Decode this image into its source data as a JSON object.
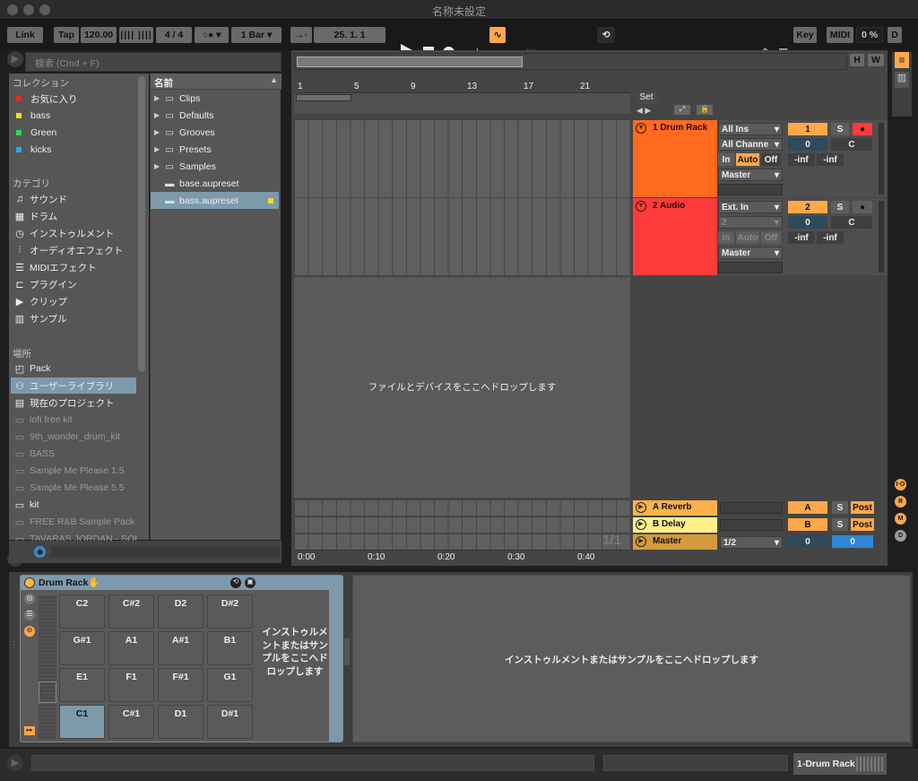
{
  "window": {
    "title": "名称未設定"
  },
  "control_bar": {
    "link": "Link",
    "tap": "Tap",
    "tempo": "120.00",
    "signature": "4 / 4",
    "quantize": "1 Bar",
    "position": "25.  1.  1",
    "key": "Key",
    "midi": "MIDI",
    "cpu": "0 %",
    "d": "D"
  },
  "search": {
    "placeholder": "検索 (Cmd + F)"
  },
  "sidebar": {
    "collections_header": "コレクション",
    "collections": [
      {
        "label": "お気に入り",
        "color": "#e52a2a"
      },
      {
        "label": "bass",
        "color": "#f0e020"
      },
      {
        "label": "Green",
        "color": "#2fd65a"
      },
      {
        "label": "kicks",
        "color": "#2aa9e8"
      }
    ],
    "categories_header": "カテゴリ",
    "categories": [
      {
        "label": "サウンド",
        "icon": "♫"
      },
      {
        "label": "ドラム",
        "icon": "▦"
      },
      {
        "label": "インストゥルメント",
        "icon": "◷"
      },
      {
        "label": "オーディオエフェクト",
        "icon": "⫶"
      },
      {
        "label": "MIDIエフェクト",
        "icon": "☰"
      },
      {
        "label": "プラグイン",
        "icon": "⊏"
      },
      {
        "label": "クリップ",
        "icon": "▶"
      },
      {
        "label": "サンプル",
        "icon": "▥"
      }
    ],
    "places_header": "場所",
    "places": [
      {
        "label": "Pack",
        "icon": "◰",
        "dim": false
      },
      {
        "label": "ユーザーライブラリ",
        "icon": "⚇",
        "dim": false
      },
      {
        "label": "現在のプロジェクト",
        "icon": "▤",
        "dim": false
      },
      {
        "label": "lofi free kit",
        "icon": "▭",
        "dim": true
      },
      {
        "label": "9th_wonder_drum_kit",
        "icon": "▭",
        "dim": true
      },
      {
        "label": "BASS",
        "icon": "▭",
        "dim": true
      },
      {
        "label": "Sample Me Please 1.5",
        "icon": "▭",
        "dim": true
      },
      {
        "label": "Sample Me Please 5.5",
        "icon": "▭",
        "dim": true
      },
      {
        "label": "kit",
        "icon": "▭",
        "dim": false
      },
      {
        "label": "FREE R&B Sample Pack",
        "icon": "▭",
        "dim": true
      },
      {
        "label": "TAVARAS JORDAN - SOL",
        "icon": "▭",
        "dim": true
      }
    ]
  },
  "files": {
    "header": "名前",
    "items": [
      {
        "label": "Clips",
        "type": "folder"
      },
      {
        "label": "Defaults",
        "type": "folder"
      },
      {
        "label": "Grooves",
        "type": "folder"
      },
      {
        "label": "Presets",
        "type": "folder"
      },
      {
        "label": "Samples",
        "type": "folder"
      },
      {
        "label": "base.aupreset",
        "type": "file"
      },
      {
        "label": "bass.aupreset",
        "type": "file"
      }
    ]
  },
  "arrangement": {
    "overview_h": "H",
    "overview_w": "W",
    "bar_numbers": [
      "1",
      "5",
      "9",
      "13",
      "17",
      "21"
    ],
    "set_label": "Set",
    "drop_hint": "ファイルとデバイスをここへドロップします",
    "page": "1/1",
    "time_labels": [
      "0:00",
      "0:10",
      "0:20",
      "0:30",
      "0:40"
    ]
  },
  "tracks": [
    {
      "name": "1 Drum Rack",
      "color": "#ff6a1f",
      "input": "All Ins",
      "channel": "All Channe",
      "monitor": [
        "In",
        "Auto",
        "Off"
      ],
      "output": "Master",
      "number": "1",
      "solo": "S",
      "vol": "0",
      "pan": "C",
      "peak_l": "-inf",
      "peak_r": "-inf"
    },
    {
      "name": "2 Audio",
      "color": "#ff3a3a",
      "input": "Ext. In",
      "channel": "2",
      "monitor": [
        "In",
        "Auto",
        "Off"
      ],
      "output": "Master",
      "number": "2",
      "solo": "S",
      "vol": "0",
      "pan": "C",
      "peak_l": "-inf",
      "peak_r": "-inf"
    }
  ],
  "returns": [
    {
      "name": "A Reverb",
      "color": "#ffb24a",
      "letter": "A",
      "solo": "S",
      "post": "Post"
    },
    {
      "name": "B Delay",
      "color": "#fff08a",
      "letter": "B",
      "solo": "S",
      "post": "Post"
    }
  ],
  "master": {
    "name": "Master",
    "color": "#d39b3c",
    "output": "1/2",
    "vol": "0",
    "cue": "0"
  },
  "side_buttons": [
    "I·O",
    "R",
    "M",
    "D"
  ],
  "device": {
    "title": "Drum Rack",
    "pads": [
      [
        "C2",
        "C#2",
        "D2",
        "D#2"
      ],
      [
        "G#1",
        "A1",
        "A#1",
        "B1"
      ],
      [
        "E1",
        "F1",
        "F#1",
        "G1"
      ],
      [
        "C1",
        "C#1",
        "D1",
        "D#1"
      ]
    ],
    "pad_drop_hint": "インストゥルメントまたはサンプルをここへドロップします",
    "main_drop_hint": "インストゥルメントまたはサンプルをここへドロップします"
  },
  "status_bar": {
    "track_name": "1-Drum Rack"
  }
}
